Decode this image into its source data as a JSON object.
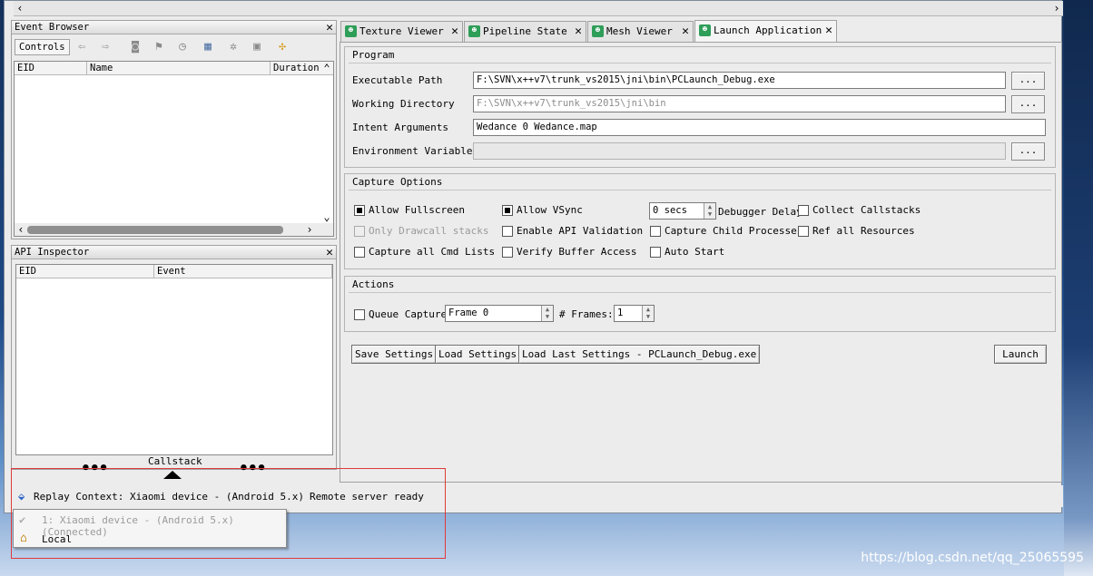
{
  "event_browser": {
    "title": "Event Browser",
    "controls_label": "Controls",
    "columns": [
      "EID",
      "Name",
      "Duration"
    ],
    "toolbar_icons": [
      "back-arrow-icon",
      "forward-arrow-icon",
      "binoculars-icon",
      "flag-icon",
      "clock-icon",
      "bookmark-icon",
      "settings-gear-icon",
      "save-icon",
      "puzzle-icon"
    ]
  },
  "api_inspector": {
    "title": "API Inspector",
    "columns": [
      "EID",
      "Event"
    ],
    "callstack_label": "Callstack"
  },
  "tabs": [
    {
      "label": "Texture Viewer"
    },
    {
      "label": "Pipeline State"
    },
    {
      "label": "Mesh Viewer"
    },
    {
      "label": "Launch Application"
    }
  ],
  "program": {
    "title": "Program",
    "executable_path_label": "Executable Path",
    "executable_path": "F:\\SVN\\x++v7\\trunk_vs2015\\jni\\bin\\PCLaunch_Debug.exe",
    "working_directory_label": "Working Directory",
    "working_directory": "F:\\SVN\\x++v7\\trunk_vs2015\\jni\\bin",
    "intent_arguments_label": "Intent Arguments",
    "intent_arguments": "Wedance 0 Wedance.map",
    "environment_variables_label": "Environment Variables",
    "environment_variables": "",
    "browse_label": "..."
  },
  "capture_options": {
    "title": "Capture Options",
    "allow_fullscreen": "Allow Fullscreen",
    "allow_vsync": "Allow VSync",
    "debugger_delay_value": "0 secs",
    "debugger_delay_label": "Debugger Delay",
    "collect_callstacks": "Collect Callstacks",
    "only_drawcall_stacks": "Only Drawcall stacks",
    "enable_api_validation": "Enable API Validation",
    "capture_child_processes": "Capture Child Processes",
    "ref_all_resources": "Ref all Resources",
    "capture_all_cmd_lists": "Capture all Cmd Lists",
    "verify_buffer_access": "Verify Buffer Access",
    "auto_start": "Auto Start"
  },
  "actions": {
    "title": "Actions",
    "queue_capture": "Queue Capture",
    "frame_value": "Frame 0",
    "frames_label": "# Frames:",
    "frames_value": "1"
  },
  "buttons": {
    "save_settings": "Save Settings",
    "load_settings": "Load Settings",
    "load_last_settings": "Load Last Settings - PCLaunch_Debug.exe",
    "launch": "Launch"
  },
  "status": {
    "replay_context": "Replay Context: Xiaomi device - (Android 5.x)",
    "remote_status": "Remote server ready"
  },
  "context_menu": {
    "items": [
      {
        "label": "1: Xiaomi device - (Android 5.x) (Connected)",
        "enabled": false
      },
      {
        "label": "Local",
        "enabled": true
      }
    ]
  },
  "watermark": "https://blog.csdn.net/qq_25065595"
}
